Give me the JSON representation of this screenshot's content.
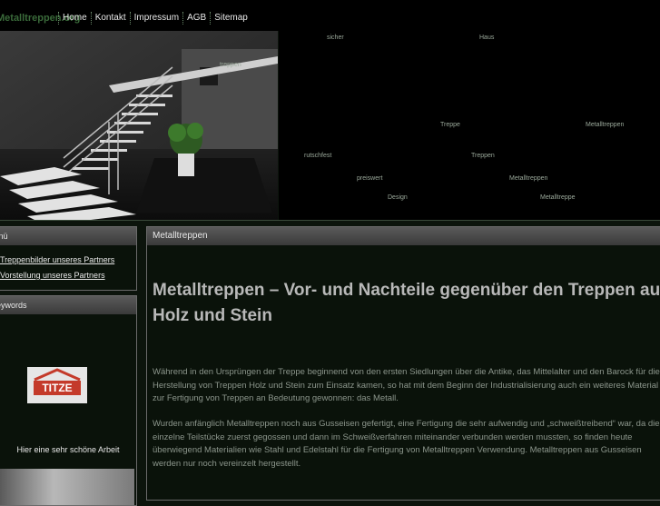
{
  "header": {
    "logo": "Metalltreppen.org",
    "nav": [
      "Home",
      "Kontakt",
      "Impressum",
      "AGB",
      "Sitemap"
    ]
  },
  "tags": {
    "sicher": "sicher",
    "haus": "Haus",
    "treppen_small": "treppen",
    "treppe": "Treppe",
    "metalltreppen1": "Metalltreppen",
    "rutschfest": "rutschfest",
    "treppen": "Treppen",
    "preiswert": "preiswert",
    "metalltreppen2": "Metalltreppen",
    "design": "Design",
    "metalltreppe": "Metalltreppe"
  },
  "sidebar": {
    "menu_title": "Menü",
    "links": [
      "Treppenbilder unseres Partners",
      "Vorstellung unseres Partners"
    ],
    "keywords_title": "Keywords",
    "partner_logo": "TITZE",
    "partner_caption": "Hier eine sehr schöne Arbeit"
  },
  "main": {
    "section_title": "Metalltreppen",
    "heading": "Metalltreppen – Vor- und Nachteile gegenüber den Treppen aus Holz und Stein",
    "paragraph1": "Während in den Ursprüngen der Treppe beginnend von den ersten Siedlungen über die Antike, das Mittelalter und den Barock für die Herstellung von Treppen Holz und Stein zum Einsatz kamen, so hat mit dem Beginn der Industrialisierung auch ein weiteres Material zur Fertigung von Treppen an Bedeutung gewonnen: das Metall.",
    "paragraph2": "Wurden anfänglich Metalltreppen noch aus Gusseisen gefertigt, eine Fertigung die sehr aufwendig und „schweißtreibend“ war, da die einzelne Teilstücke zuerst gegossen und dann im Schweißverfahren miteinander verbunden werden mussten, so finden heute überwiegend Materialien wie Stahl und Edelstahl für die Fertigung von Metalltreppen Verwendung. Metalltreppen aus Gusseisen werden nur noch vereinzelt hergestellt."
  }
}
